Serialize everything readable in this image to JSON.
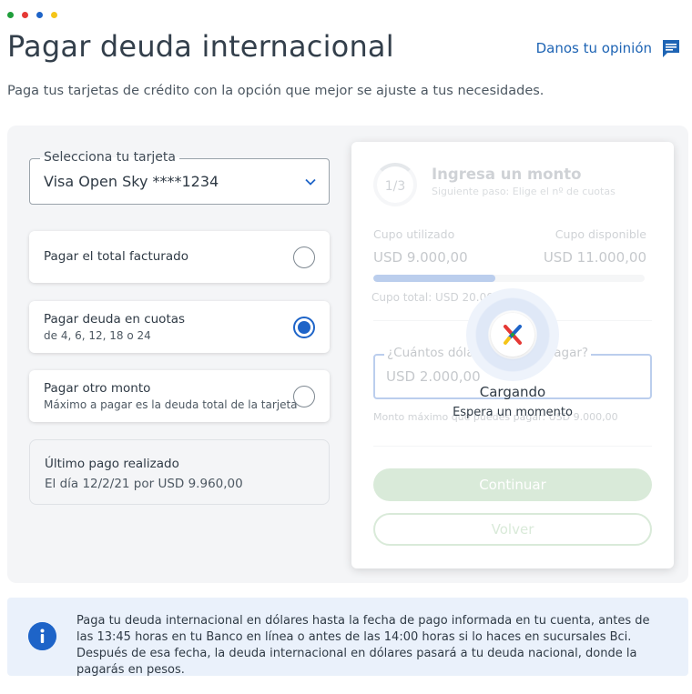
{
  "window_dots": [
    "#1f9e3b",
    "#e53935",
    "#1e64c8",
    "#f5c518"
  ],
  "header": {
    "title": "Pagar deuda internacional",
    "feedback_label": "Danos tu opinión",
    "subtitle": "Paga tus tarjetas de crédito con la opción que mejor se ajuste a tus necesidades."
  },
  "card_select": {
    "label": "Selecciona tu tarjeta",
    "value": "Visa Open Sky ****1234"
  },
  "options": [
    {
      "title": "Pagar el total facturado",
      "subtitle": "",
      "selected": false
    },
    {
      "title": "Pagar deuda en cuotas",
      "subtitle": "de 4, 6, 12, 18 o 24",
      "selected": true
    },
    {
      "title": "Pagar otro monto",
      "subtitle": "Máximo a pagar es la deuda total de la tarjeta",
      "selected": false
    }
  ],
  "last_payment": {
    "title": "Último pago realizado",
    "detail": "El día 12/2/21 por USD 9.960,00"
  },
  "step_card": {
    "step": "1/3",
    "heading": "Ingresa un monto",
    "next_step": "Siguiente paso: Elige el nº de cuotas",
    "used_label": "Cupo utilizado",
    "available_label": "Cupo disponible",
    "used_value": "USD 9.000,00",
    "available_value": "USD 11.000,00",
    "used_fraction": 0.45,
    "total": "Cupo total: USD 20.000,00",
    "amount_label": "¿Cuántos dólares quieres pagar?",
    "amount_value": "USD 2.000,00",
    "max_amount": "Monto máximo que puedes pagar: USD 9.000,00",
    "continue_label": "Continuar",
    "back_label": "Volver"
  },
  "loading": {
    "title": "Cargando",
    "subtitle": "Espera un momento"
  },
  "info": {
    "text": "Paga tu deuda internacional en dólares hasta la fecha de pago informada en tu cuenta, antes de las 13:45 horas en tu Banco en línea o antes de las 14:00 horas si lo haces en sucursales Bci. Después de esa fecha, la deuda internacional en dólares pasará a tu deuda nacional, donde la pagarás en pesos."
  },
  "colors": {
    "brand_blue": "#1e64c8",
    "green_button": "#8cc08a",
    "panel_bg": "#f4f5f7",
    "info_bg": "#eaf1fb"
  }
}
